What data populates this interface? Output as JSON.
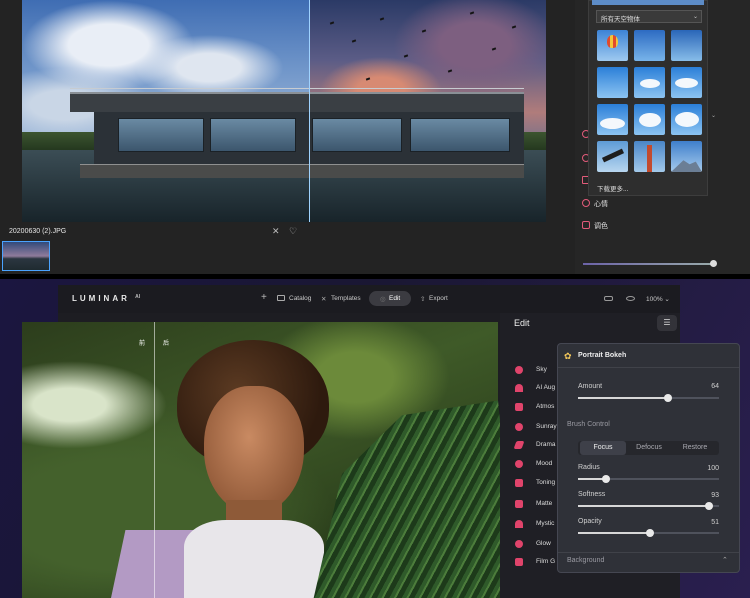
{
  "top": {
    "filename": "20200630 (2).JPG",
    "close_symbol": "✕",
    "heart_symbol": "♡",
    "sky_popup": {
      "selected_category": "所有天空物体",
      "download_more": "下载更多..."
    },
    "side_items": [
      "心情",
      "调色"
    ]
  },
  "bottom": {
    "app": {
      "logo": "LUMINAR",
      "logo_sup": "AI"
    },
    "nav": {
      "add": "+",
      "catalog": "Catalog",
      "templates": "Templates",
      "edit": "Edit",
      "export": "Export",
      "zoom": "100% ⌄"
    },
    "canvas": {
      "before_label": "前",
      "after_label": "后"
    },
    "edit_title": "Edit",
    "tools": [
      "Sky",
      "AI Aug",
      "Atmos",
      "Sunray",
      "Drama",
      "Mood",
      "Toning",
      "Matte",
      "Mystic",
      "Glow",
      "Film G"
    ],
    "bokeh": {
      "title": "Portrait Bokeh",
      "amount": {
        "label": "Amount",
        "value": 64
      },
      "brush_control": "Brush Control",
      "segments": [
        "Focus",
        "Defocus",
        "Restore"
      ],
      "active_segment": "Focus",
      "radius": {
        "label": "Radius",
        "value": 100
      },
      "softness": {
        "label": "Softness",
        "value": 93
      },
      "opacity": {
        "label": "Opacity",
        "value": 51
      },
      "background": "Background"
    }
  },
  "colors": {
    "accent_blue": "#4aa3ff",
    "tool_pink": "#e0446b",
    "bokeh_icon": "#f3c85b"
  }
}
